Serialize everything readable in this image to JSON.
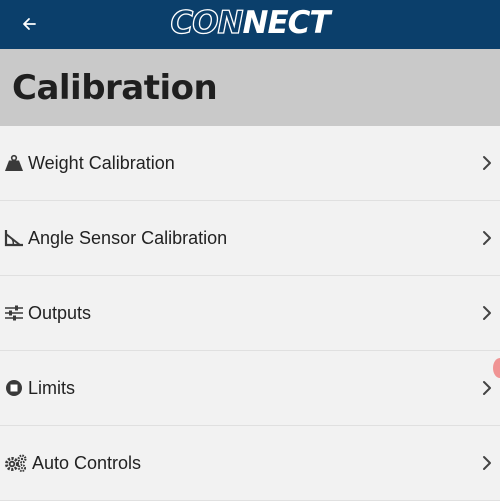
{
  "app": {
    "logo_part1": "CON",
    "logo_part2": "NECT",
    "brand_color": "#0b3f6b",
    "back_icon": "arrow-left-icon"
  },
  "page": {
    "title": "Calibration"
  },
  "menu": {
    "items": [
      {
        "label": "Weight Calibration",
        "icon": "weight-icon"
      },
      {
        "label": "Angle Sensor Calibration",
        "icon": "angle-icon"
      },
      {
        "label": "Outputs",
        "icon": "sliders-icon"
      },
      {
        "label": "Limits",
        "icon": "stop-circle-icon"
      },
      {
        "label": "Auto Controls",
        "icon": "gears-icon"
      }
    ]
  }
}
